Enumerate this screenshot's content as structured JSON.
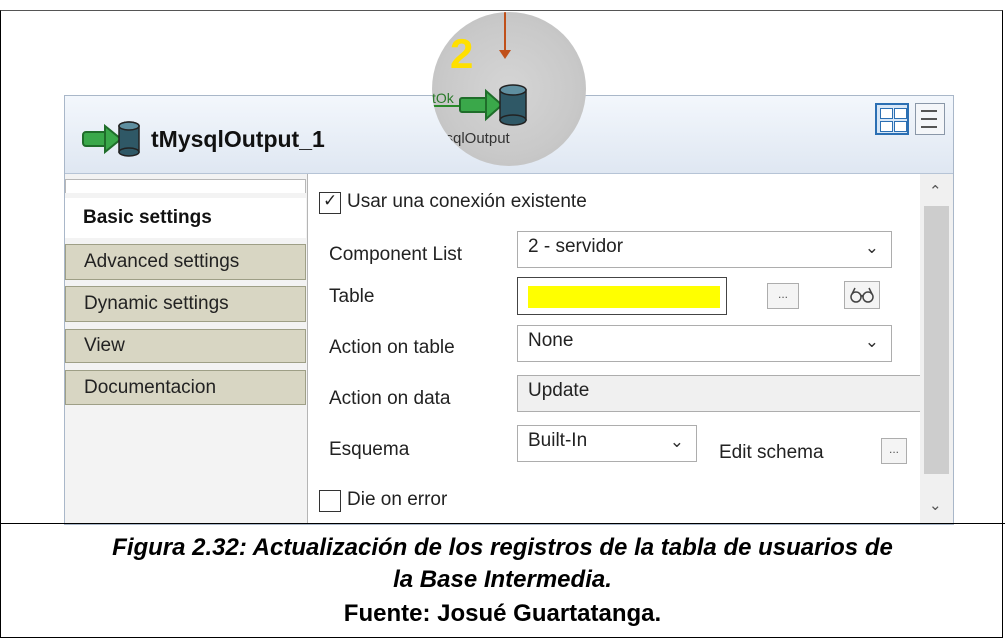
{
  "component": {
    "title": "tMysqlOutput_1",
    "icon": "mysql-output-icon"
  },
  "overlay": {
    "step_number": "2",
    "link_label": "tOk",
    "node_label": "ysqlOutput"
  },
  "tabs": [
    {
      "label": "Basic settings",
      "active": true
    },
    {
      "label": "Advanced settings",
      "active": false
    },
    {
      "label": "Dynamic settings",
      "active": false
    },
    {
      "label": "View",
      "active": false
    },
    {
      "label": "Documentacion",
      "active": false
    }
  ],
  "settings": {
    "use_existing_connection": {
      "label": "Usar una conexión existente",
      "checked": true
    },
    "component_list": {
      "label": "Component List",
      "value": "2 - servidor"
    },
    "table": {
      "label": "Table",
      "value": "",
      "browse_label": "...",
      "highlight": "#ffff00"
    },
    "action_on_table": {
      "label": "Action on table",
      "value": "None"
    },
    "action_on_data": {
      "label": "Action on data",
      "value": "Update"
    },
    "schema": {
      "label": "Esquema",
      "value": "Built-In",
      "edit_label": "Edit schema",
      "edit_button": "..."
    },
    "die_on_error": {
      "label": "Die on error",
      "checked": false
    }
  },
  "caption": {
    "line1": "Figura 2.32: Actualización de los registros de la tabla de usuarios de",
    "line2": "la Base Intermedia.",
    "source": "Fuente: Josué Guartatanga."
  }
}
